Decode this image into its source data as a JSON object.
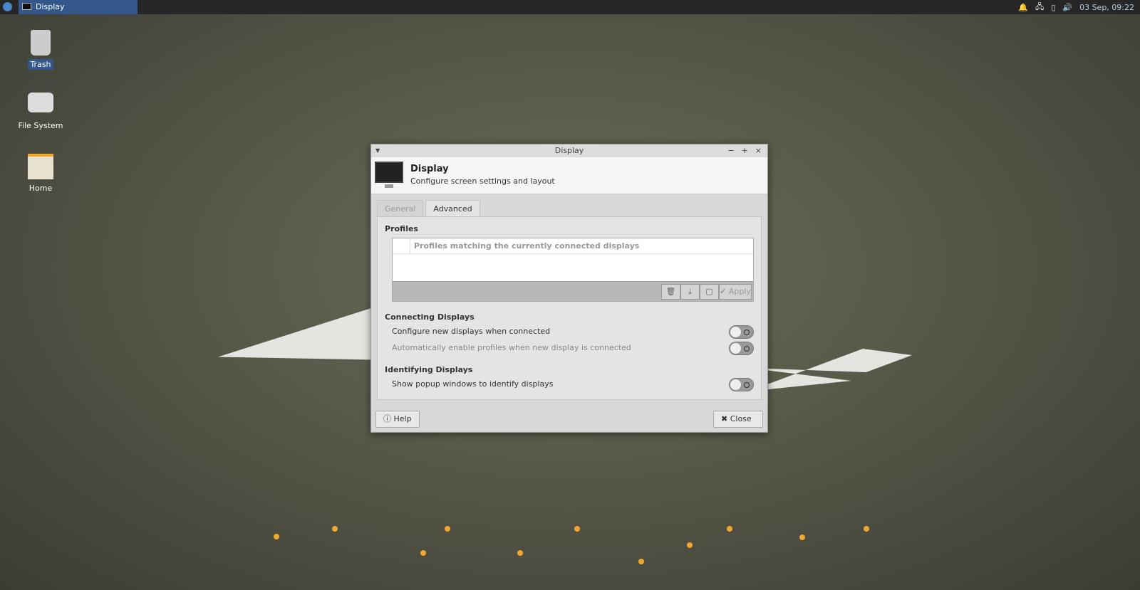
{
  "panel": {
    "task_title": "Display",
    "clock": "03 Sep, 09:22"
  },
  "desktop": {
    "icons": [
      {
        "label": "Trash"
      },
      {
        "label": "File System"
      },
      {
        "label": "Home"
      }
    ]
  },
  "window": {
    "title": "Display",
    "header_title": "Display",
    "header_subtitle": "Configure screen settings and layout",
    "tabs": [
      {
        "label": "General"
      },
      {
        "label": "Advanced"
      }
    ],
    "profiles": {
      "heading": "Profiles",
      "column": "Profiles matching the currently connected displays",
      "apply": "Apply"
    },
    "connecting": {
      "heading": "Connecting Displays",
      "options": [
        {
          "label": "Configure new displays when connected",
          "on": false
        },
        {
          "label": "Automatically enable profiles when new display is connected",
          "on": false
        }
      ]
    },
    "identifying": {
      "heading": "Identifying Displays",
      "options": [
        {
          "label": "Show popup windows to identify displays",
          "on": false
        }
      ]
    },
    "help": "Help",
    "close": "Close"
  }
}
